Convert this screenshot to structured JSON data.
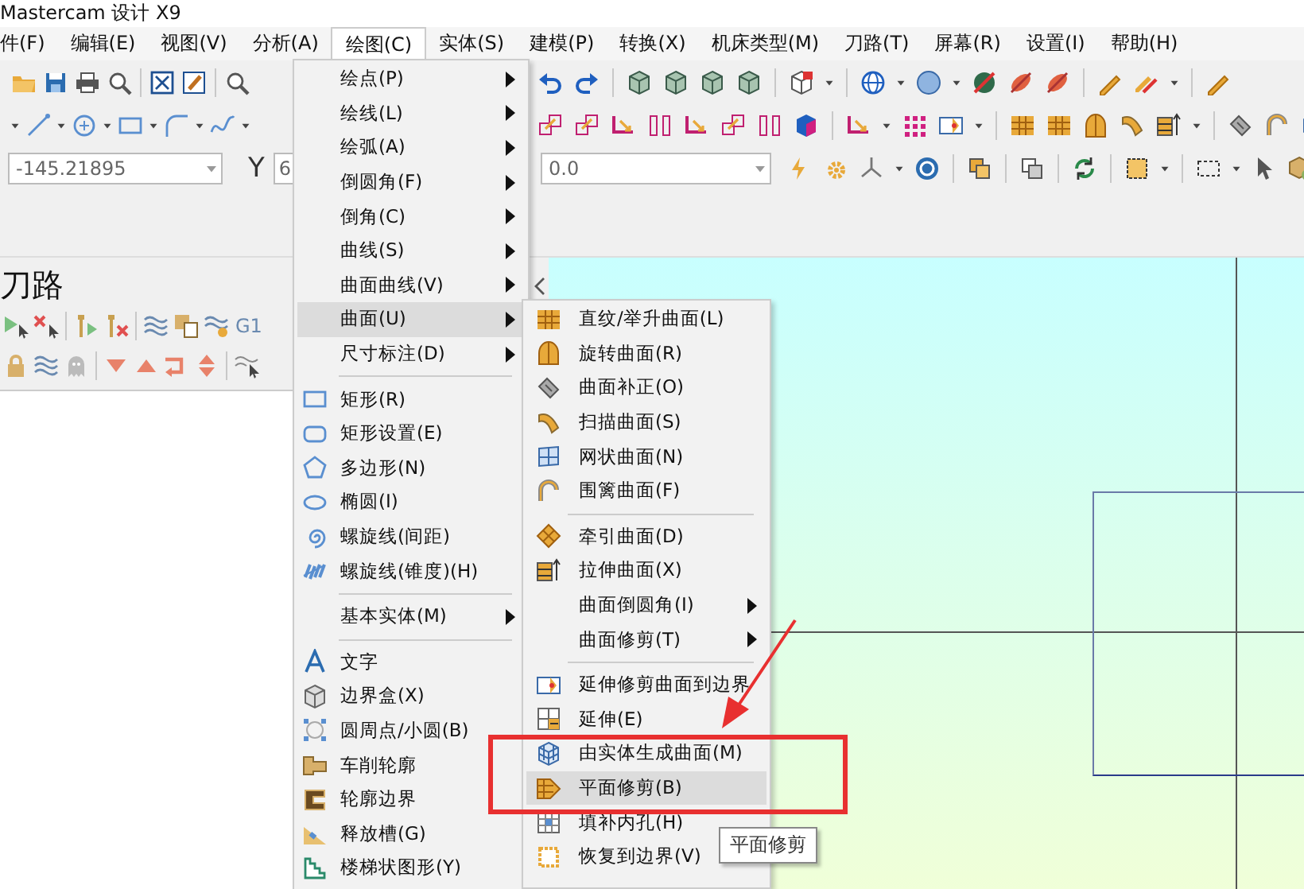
{
  "window": {
    "title": "Mastercam 设计 X9"
  },
  "menu_bar": [
    {
      "label": "件(F)",
      "selected": false
    },
    {
      "label": "编辑(E)",
      "selected": false
    },
    {
      "label": "视图(V)",
      "selected": false
    },
    {
      "label": "分析(A)",
      "selected": false
    },
    {
      "label": "绘图(C)",
      "selected": true
    },
    {
      "label": "实体(S)",
      "selected": false
    },
    {
      "label": "建模(P)",
      "selected": false
    },
    {
      "label": "转换(X)",
      "selected": false
    },
    {
      "label": "机床类型(M)",
      "selected": false
    },
    {
      "label": "刀路(T)",
      "selected": false
    },
    {
      "label": "屏幕(R)",
      "selected": false
    },
    {
      "label": "设置(I)",
      "selected": false
    },
    {
      "label": "帮助(H)",
      "selected": false
    }
  ],
  "coordinate_bar": {
    "x_value": "-145.21895",
    "y_label": "Y",
    "y_value": "6",
    "z_value": "0.0"
  },
  "toolpath_panel": {
    "title": "刀路",
    "code_label": "G1"
  },
  "draw_menu": {
    "items": [
      {
        "kind": "submenu",
        "label": "绘点(P)",
        "selected": false
      },
      {
        "kind": "submenu",
        "label": "绘线(L)",
        "selected": false
      },
      {
        "kind": "submenu",
        "label": "绘弧(A)",
        "selected": false
      },
      {
        "kind": "submenu",
        "label": "倒圆角(F)",
        "selected": false
      },
      {
        "kind": "submenu",
        "label": "倒角(C)",
        "selected": false
      },
      {
        "kind": "submenu",
        "label": "曲线(S)",
        "selected": false
      },
      {
        "kind": "submenu",
        "label": "曲面曲线(V)",
        "selected": false
      },
      {
        "kind": "submenu",
        "label": "曲面(U)",
        "selected": true
      },
      {
        "kind": "submenu",
        "label": "尺寸标注(D)",
        "selected": false
      },
      {
        "kind": "separator"
      },
      {
        "kind": "command",
        "label": "矩形(R)",
        "selected": false
      },
      {
        "kind": "command",
        "label": "矩形设置(E)",
        "selected": false
      },
      {
        "kind": "command",
        "label": "多边形(N)",
        "selected": false
      },
      {
        "kind": "command",
        "label": "椭圆(I)",
        "selected": false
      },
      {
        "kind": "command",
        "label": "螺旋线(间距)",
        "selected": false
      },
      {
        "kind": "command",
        "label": "螺旋线(锥度)(H)",
        "selected": false
      },
      {
        "kind": "separator"
      },
      {
        "kind": "submenu",
        "label": "基本实体(M)",
        "selected": false
      },
      {
        "kind": "separator"
      },
      {
        "kind": "command",
        "label": "文字",
        "selected": false
      },
      {
        "kind": "command",
        "label": "边界盒(X)",
        "selected": false
      },
      {
        "kind": "command",
        "label": "圆周点/小圆(B)",
        "selected": false
      },
      {
        "kind": "command",
        "label": "车削轮廓",
        "selected": false
      },
      {
        "kind": "command",
        "label": "轮廓边界",
        "selected": false
      },
      {
        "kind": "command",
        "label": "释放槽(G)",
        "selected": false
      },
      {
        "kind": "command",
        "label": "楼梯状图形(Y)",
        "selected": false
      }
    ]
  },
  "surface_submenu": {
    "items": [
      {
        "kind": "command",
        "label": "直纹/举升曲面(L)",
        "selected": false
      },
      {
        "kind": "command",
        "label": "旋转曲面(R)",
        "selected": false
      },
      {
        "kind": "command",
        "label": "曲面补正(O)",
        "selected": false
      },
      {
        "kind": "command",
        "label": "扫描曲面(S)",
        "selected": false
      },
      {
        "kind": "command",
        "label": "网状曲面(N)",
        "selected": false
      },
      {
        "kind": "command",
        "label": "围篱曲面(F)",
        "selected": false
      },
      {
        "kind": "separator"
      },
      {
        "kind": "command",
        "label": "牵引曲面(D)",
        "selected": false
      },
      {
        "kind": "command",
        "label": "拉伸曲面(X)",
        "selected": false
      },
      {
        "kind": "submenu",
        "label": "曲面倒圆角(I)",
        "selected": false
      },
      {
        "kind": "submenu",
        "label": "曲面修剪(T)",
        "selected": false
      },
      {
        "kind": "separator"
      },
      {
        "kind": "command",
        "label": "延伸修剪曲面到边界",
        "selected": false
      },
      {
        "kind": "command",
        "label": "延伸(E)",
        "selected": false
      },
      {
        "kind": "command",
        "label": "由实体生成曲面(M)",
        "selected": false
      },
      {
        "kind": "command",
        "label": "平面修剪(B)",
        "selected": true
      },
      {
        "kind": "command",
        "label": "填补内孔(H)",
        "selected": false
      },
      {
        "kind": "command",
        "label": "恢复到边界(V)",
        "selected": false
      }
    ]
  },
  "tooltip": "平面修剪"
}
